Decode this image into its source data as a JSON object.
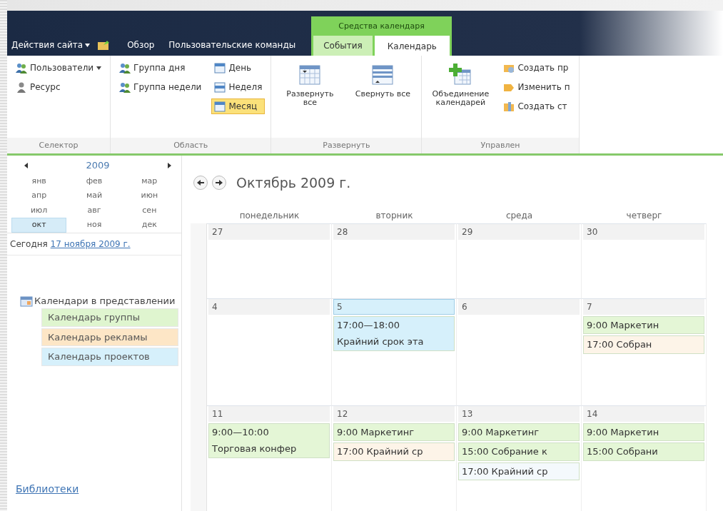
{
  "header": {
    "site_actions": "Действия сайта",
    "tabs": [
      {
        "label": "Обзор",
        "selected": false
      },
      {
        "label": "Пользовательские команды",
        "selected": false
      }
    ],
    "context_group": {
      "title": "Средства календаря",
      "tabs": [
        {
          "label": "События",
          "selected": false
        },
        {
          "label": "Календарь",
          "selected": true
        }
      ]
    }
  },
  "ribbon": {
    "groups": [
      {
        "label": "Селектор",
        "columns": [
          [
            {
              "kind": "small",
              "label": "Пользователи",
              "dropdown": true
            },
            {
              "kind": "small",
              "label": "Ресурс"
            }
          ]
        ]
      },
      {
        "label": "Область",
        "columns": [
          [
            {
              "kind": "small",
              "label": "Группа дня",
              "selected": false
            },
            {
              "kind": "small",
              "label": "Группа недели",
              "selected": false
            }
          ],
          [
            {
              "kind": "small",
              "label": "День",
              "selected": false
            },
            {
              "kind": "small",
              "label": "Неделя",
              "selected": false
            },
            {
              "kind": "small",
              "label": "Месяц",
              "selected": true
            }
          ]
        ]
      },
      {
        "label": "Развернуть",
        "columns": [
          [
            {
              "kind": "large",
              "label": "Развернуть все"
            }
          ],
          [
            {
              "kind": "large",
              "label": "Свернуть все"
            }
          ]
        ]
      },
      {
        "label": "Управлен",
        "columns": [
          [
            {
              "kind": "large",
              "label": "Объединение календарей"
            }
          ],
          [
            {
              "kind": "small",
              "label": "Создать пр"
            },
            {
              "kind": "small",
              "label": "Изменить п"
            },
            {
              "kind": "small",
              "label": "Создать ст"
            }
          ]
        ]
      }
    ]
  },
  "sidebar": {
    "year": "2009",
    "months": [
      {
        "label": "янв",
        "selected": false
      },
      {
        "label": "фев",
        "selected": false
      },
      {
        "label": "мар",
        "selected": false
      },
      {
        "label": "апр",
        "selected": false
      },
      {
        "label": "май",
        "selected": false
      },
      {
        "label": "июн",
        "selected": false
      },
      {
        "label": "июл",
        "selected": false
      },
      {
        "label": "авг",
        "selected": false
      },
      {
        "label": "сен",
        "selected": false
      },
      {
        "label": "окт",
        "selected": true
      },
      {
        "label": "ноя",
        "selected": false
      },
      {
        "label": "дек",
        "selected": false
      }
    ],
    "today": {
      "label": "Сегодня",
      "link": "17 ноября 2009 г."
    },
    "calendars_heading": "Календари в представлении",
    "calendars": [
      {
        "label": "Календарь группы",
        "color": "#dff5cf"
      },
      {
        "label": "Календарь рекламы",
        "color": "#fde6c6"
      },
      {
        "label": "Календарь проектов",
        "color": "#d6f0fb"
      }
    ],
    "libraries": "Библиотеки"
  },
  "calendar": {
    "title": "Октябрь 2009 г.",
    "weekdays": [
      "понедельник",
      "вторник",
      "среда",
      "четверг"
    ],
    "weeks": [
      {
        "days": [
          {
            "date": "27",
            "selected": false
          },
          {
            "date": "28",
            "selected": false
          },
          {
            "date": "29",
            "selected": false
          },
          {
            "date": "30",
            "selected": false
          }
        ]
      },
      {
        "days": [
          {
            "date": "4",
            "selected": false
          },
          {
            "date": "5",
            "selected": true,
            "events": [
              {
                "lines": [
                  "17:00—18:00",
                  "Крайний срок эта"
                ],
                "color": "#d6f0fb"
              }
            ]
          },
          {
            "date": "6",
            "selected": false
          },
          {
            "date": "7",
            "selected": false,
            "events": [
              {
                "lines": [
                  "9:00 Маркетин"
                ],
                "color": "#e4f6d6"
              },
              {
                "lines": [
                  "17:00 Собран"
                ],
                "color": "#fdf4e8"
              }
            ]
          }
        ]
      },
      {
        "days": [
          {
            "date": "11",
            "selected": false,
            "events": [
              {
                "lines": [
                  "9:00—10:00",
                  "Торговая конфер"
                ],
                "color": "#e4f6d6"
              }
            ]
          },
          {
            "date": "12",
            "selected": false,
            "events": [
              {
                "lines": [
                  "9:00 Маркетинг"
                ],
                "color": "#e4f6d6"
              },
              {
                "lines": [
                  "17:00 Крайний ср"
                ],
                "color": "#fdf4e8"
              }
            ]
          },
          {
            "date": "13",
            "selected": false,
            "events": [
              {
                "lines": [
                  "9:00 Маркетинг"
                ],
                "color": "#e4f6d6"
              },
              {
                "lines": [
                  "15:00 Собрание к"
                ],
                "color": "#e4f6d6"
              },
              {
                "lines": [
                  "17:00 Крайний ср"
                ],
                "color": "#f4f9fc"
              }
            ]
          },
          {
            "date": "14",
            "selected": false,
            "events": [
              {
                "lines": [
                  "9:00 Маркетин"
                ],
                "color": "#e4f6d6"
              },
              {
                "lines": [
                  "15:00 Собрани"
                ],
                "color": "#e4f6d6"
              }
            ]
          }
        ]
      }
    ]
  }
}
